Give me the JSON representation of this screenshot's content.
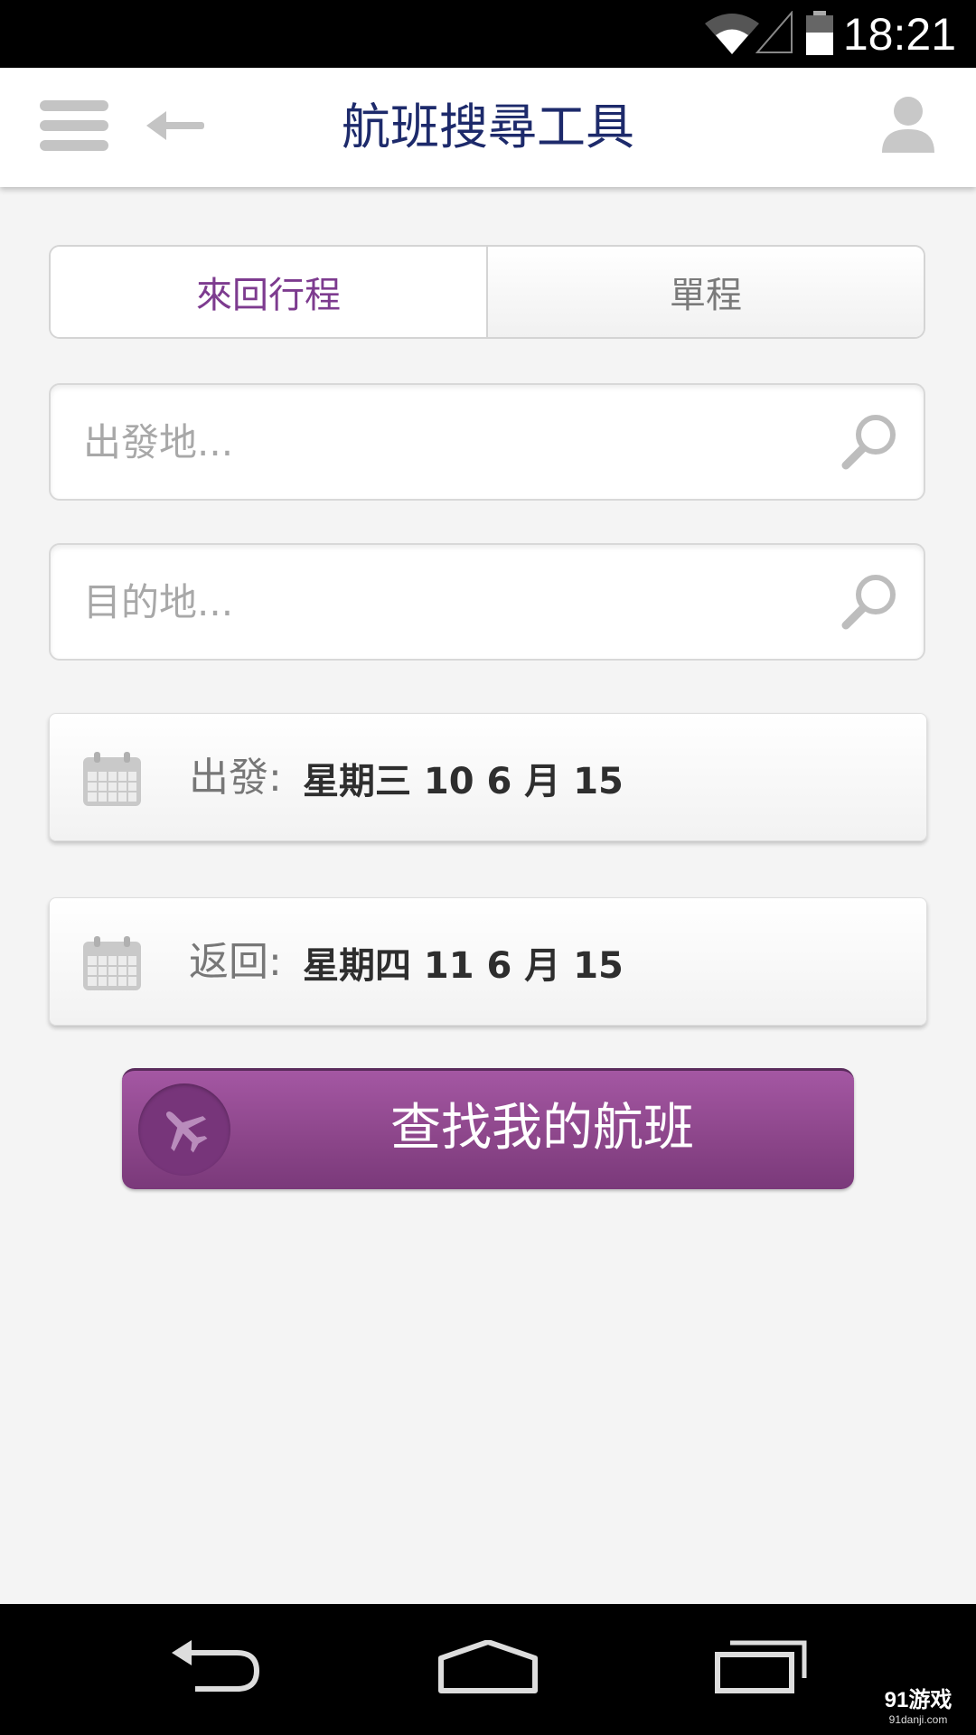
{
  "status_bar": {
    "time": "18:21",
    "icons": [
      "wifi-icon",
      "signal-icon",
      "battery-icon"
    ]
  },
  "header": {
    "title": "航班搜尋工具",
    "icons": [
      "menu-icon",
      "back-arrow-icon",
      "user-profile-icon"
    ]
  },
  "trip_type": {
    "tabs": [
      {
        "label": "來回行程",
        "active": true
      },
      {
        "label": "單程",
        "active": false
      }
    ]
  },
  "search": {
    "origin": {
      "placeholder": "出發地...",
      "value": ""
    },
    "destination": {
      "placeholder": "目的地...",
      "value": ""
    }
  },
  "dates": {
    "departure": {
      "label": "出發:",
      "value": "星期三 10 6 月 15"
    },
    "return": {
      "label": "返回:",
      "value": "星期四 11 6 月 15"
    }
  },
  "find_button": {
    "label": "查找我的航班"
  },
  "nav_bar": {
    "icons": [
      "nav-back-icon",
      "nav-home-icon",
      "nav-recents-icon"
    ]
  },
  "watermark": {
    "main": "91游戏",
    "sub": "91danji.com"
  },
  "colors": {
    "title": "#1d2a6b",
    "accent": "#7d3b8f",
    "button": "#8b4589",
    "background": "#f4f4f4"
  }
}
